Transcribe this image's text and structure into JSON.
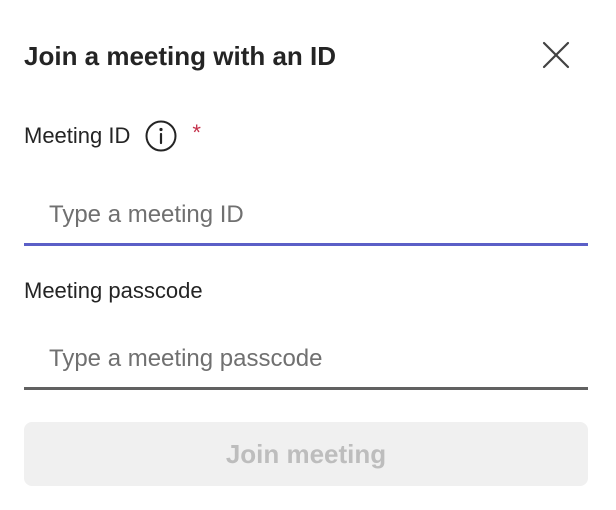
{
  "dialog": {
    "title": "Join a meeting with an ID",
    "close_icon": "close-icon"
  },
  "meeting_id": {
    "label": "Meeting ID",
    "info_icon": "info-icon",
    "required_marker": "*",
    "placeholder": "Type a meeting ID",
    "value": ""
  },
  "passcode": {
    "label": "Meeting passcode",
    "placeholder": "Type a meeting passcode",
    "value": ""
  },
  "actions": {
    "join_label": "Join meeting",
    "join_enabled": false
  },
  "colors": {
    "focus_underline": "#5b5fc7",
    "default_underline": "#616161",
    "required": "#c4314b",
    "disabled_button_bg": "#f0f0f0",
    "disabled_button_text": "#bdbdbd"
  }
}
